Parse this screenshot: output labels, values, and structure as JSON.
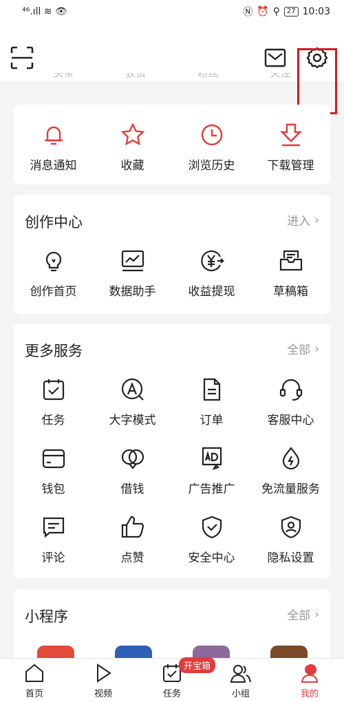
{
  "status": {
    "left_icons": "⁴⁶.ıll ≋ 👁",
    "battery": "27",
    "time": "10:03"
  },
  "stats_row": [
    "头条",
    "获赞",
    "粉丝",
    "关注"
  ],
  "quick_actions": [
    {
      "label": "消息通知",
      "icon": "bell-icon"
    },
    {
      "label": "收藏",
      "icon": "star-icon"
    },
    {
      "label": "浏览历史",
      "icon": "clock-icon"
    },
    {
      "label": "下载管理",
      "icon": "download-icon"
    }
  ],
  "creation": {
    "title": "创作中心",
    "more": "进入",
    "items": [
      {
        "label": "创作首页",
        "icon": "lightbulb-icon"
      },
      {
        "label": "数据助手",
        "icon": "chart-icon"
      },
      {
        "label": "收益提现",
        "icon": "yuan-icon"
      },
      {
        "label": "草稿箱",
        "icon": "drafts-icon"
      }
    ]
  },
  "services": {
    "title": "更多服务",
    "more": "全部",
    "items": [
      {
        "label": "任务",
        "icon": "task-icon"
      },
      {
        "label": "大字模式",
        "icon": "large-font-icon"
      },
      {
        "label": "订单",
        "icon": "order-icon"
      },
      {
        "label": "客服中心",
        "icon": "headset-icon"
      },
      {
        "label": "钱包",
        "icon": "wallet-icon"
      },
      {
        "label": "借钱",
        "icon": "loan-icon"
      },
      {
        "label": "广告推广",
        "icon": "ad-icon"
      },
      {
        "label": "免流量服务",
        "icon": "data-free-icon"
      },
      {
        "label": "评论",
        "icon": "comment-icon"
      },
      {
        "label": "点赞",
        "icon": "thumbs-up-icon"
      },
      {
        "label": "安全中心",
        "icon": "shield-icon"
      },
      {
        "label": "隐私设置",
        "icon": "privacy-icon"
      }
    ]
  },
  "mini_programs": {
    "title": "小程序",
    "more": "全部"
  },
  "tabs": [
    {
      "label": "首页",
      "icon": "home-icon"
    },
    {
      "label": "视频",
      "icon": "play-icon"
    },
    {
      "label": "任务",
      "icon": "task-tab-icon",
      "badge": "开宝箱"
    },
    {
      "label": "小组",
      "icon": "group-icon"
    },
    {
      "label": "我的",
      "icon": "profile-icon",
      "active": true
    }
  ],
  "colors": {
    "accent": "#e23b3b",
    "highlight": "#d7191f",
    "background": "#f4f4f4"
  }
}
